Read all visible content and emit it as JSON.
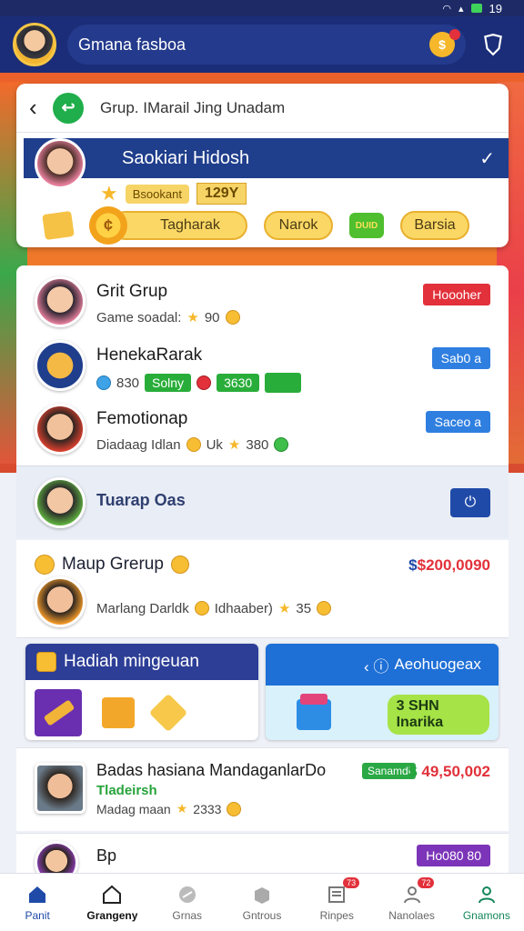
{
  "status_bar": {
    "time": "19"
  },
  "top_bar": {
    "search_text": "Gmana fasboa"
  },
  "group_card": {
    "title": "Grup. IMarail Jing Unadam",
    "banner_name": "Saokiari Hidosh",
    "rank_label": "Bsookant",
    "rank_value": "129Y",
    "actions": [
      "Tagharak",
      "Narok",
      "Barsia"
    ],
    "gift_label": "DUID"
  },
  "members": [
    {
      "name": "Grit Grup",
      "sub": "Game soadal:",
      "score": "90",
      "tag": "Hoooher",
      "tag_color": "#e2313b"
    },
    {
      "name": "HenekaRarak",
      "score": "830",
      "chip1": "Solny",
      "chip2": "3630",
      "tag": "Sab0 a",
      "tag_color": "#2f7fe0"
    },
    {
      "name": "Femotionap",
      "sub": "Diadaag Idlan",
      "extra": "Uk",
      "score": "380",
      "tag": "Saceo a",
      "tag_color": "#2f7fe0"
    }
  ],
  "tuarap": {
    "title": "Tuarap Oas"
  },
  "map_group": {
    "title": "Maup Grerup",
    "price_prefix": "$",
    "price": "$200,0090",
    "sub": "Marlang Darldk",
    "sub2": "Idhaaber)",
    "score": "35"
  },
  "reward_left": {
    "title": "Hadiah mingeuan"
  },
  "reward_right": {
    "title": "Aeohuogeax",
    "chip": "3 SHN Inarika"
  },
  "row_badas": {
    "name": "Badas hasiana MandaganlarDo",
    "status": "Sanamdl",
    "price_prefix": "$",
    "price": "49,50,002",
    "green_label": "Tladeirsh",
    "sub": "Madag maan",
    "score": "2333"
  },
  "row_bp": {
    "name": "Bp",
    "tag": "Ho080 80"
  },
  "bottom_nav": [
    {
      "label": "Panit",
      "icon": "home-icon",
      "badge": ""
    },
    {
      "label": "Grangeny",
      "icon": "house-outline-icon",
      "badge": ""
    },
    {
      "label": "Grnas",
      "icon": "tag-icon",
      "badge": ""
    },
    {
      "label": "Gntrous",
      "icon": "box-icon",
      "badge": ""
    },
    {
      "label": "Rinpes",
      "icon": "list-icon",
      "badge": "73"
    },
    {
      "label": "Nanolaes",
      "icon": "user-icon",
      "badge": "72"
    },
    {
      "label": "Gnamons",
      "icon": "person-icon",
      "badge": ""
    }
  ],
  "colors": {
    "navy": "#1b2d78",
    "accent_blue": "#1f4aa8",
    "red": "#e2313b",
    "green": "#27a43b",
    "gold": "#f6b82a"
  }
}
